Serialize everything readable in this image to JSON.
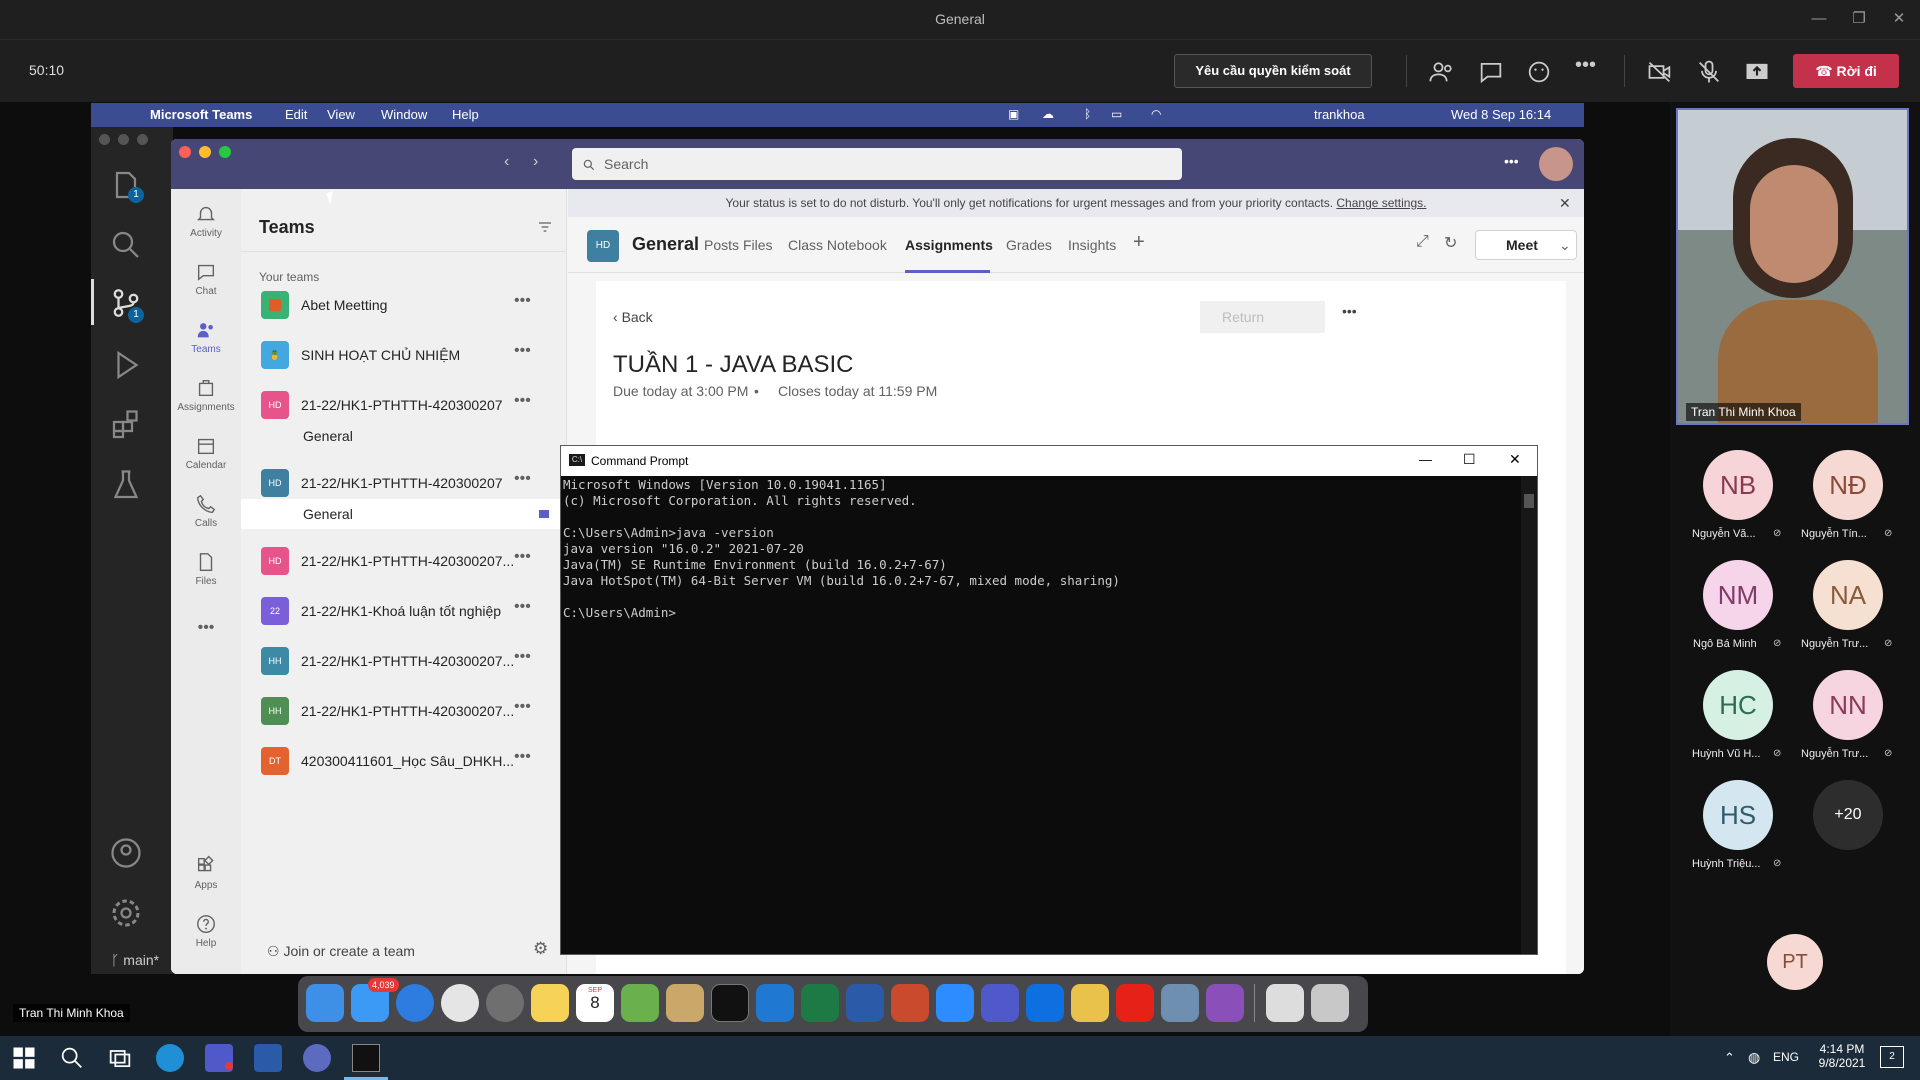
{
  "window": {
    "title": "General"
  },
  "callbar": {
    "timer": "50:10",
    "request_control": "Yêu cầu quyền kiểm soát",
    "leave": "Rời đi"
  },
  "macbar": {
    "app": "Microsoft Teams",
    "menus": [
      "Edit",
      "View",
      "Window",
      "Help"
    ],
    "user": "trankhoa",
    "datetime": "Wed 8 Sep  16:14"
  },
  "vscode": {
    "branch": "main*",
    "badge1": "1",
    "badge2": "1"
  },
  "teams": {
    "search_placeholder": "Search",
    "rail": [
      "Activity",
      "Chat",
      "Teams",
      "Assignments",
      "Calendar",
      "Calls",
      "Files",
      "Apps",
      "Help"
    ],
    "pane_title": "Teams",
    "your_teams": "Your teams",
    "team_list": [
      {
        "name": "Abet Meetting",
        "abbr": "",
        "color": "#38b275"
      },
      {
        "name": "SINH HOẠT CHỦ NHIỆM",
        "abbr": "",
        "color": "#44a7e0"
      },
      {
        "name": "21-22/HK1-PTHTTH-420300207",
        "abbr": "HD",
        "color": "#e7548c"
      },
      {
        "name": "21-22/HK1-PTHTTH-420300207",
        "abbr": "HD",
        "color": "#3f7fa0"
      },
      {
        "name": "21-22/HK1-PTHTTH-420300207...",
        "abbr": "HD",
        "color": "#e7548c"
      },
      {
        "name": "21-22/HK1-Khoá luận tốt nghiệp",
        "abbr": "22",
        "color": "#7b5fd8"
      },
      {
        "name": "21-22/HK1-PTHTTH-420300207...",
        "abbr": "HH",
        "color": "#3d8aa6"
      },
      {
        "name": "21-22/HK1-PTHTTH-420300207...",
        "abbr": "HH",
        "color": "#4f8e54"
      },
      {
        "name": "420300411601_Học Sâu_DHKH...",
        "abbr": "DT",
        "color": "#e3622f"
      }
    ],
    "channel_general": "General",
    "join_create": "Join or create a team",
    "banner": "Your status is set to do not disturb. You'll only get notifications for urgent messages and from your priority contacts.",
    "banner_link": "Change settings.",
    "channel": {
      "abbr": "HD",
      "name": "General",
      "tabs": [
        "Posts",
        "Files",
        "Class Notebook",
        "Assignments",
        "Grades",
        "Insights"
      ],
      "meet": "Meet"
    },
    "assignment": {
      "back": "Back",
      "return": "Return",
      "title": "TUẦN 1 - JAVA BASIC",
      "due": "Due today at 3:00 PM",
      "closes": "Closes today at 11:59 PM"
    }
  },
  "cmd": {
    "title": "Command Prompt",
    "lines": "Microsoft Windows [Version 10.0.19041.1165]\n(c) Microsoft Corporation. All rights reserved.\n\nC:\\Users\\Admin>java -version\njava version \"16.0.2\" 2021-07-20\nJava(TM) SE Runtime Environment (build 16.0.2+7-67)\nJava HotSpot(TM) 64-Bit Server VM (build 16.0.2+7-67, mixed mode, sharing)\n\nC:\\Users\\Admin>"
  },
  "dock": {
    "mail_badge": "4,039",
    "calendar_day": "8",
    "calendar_month": "SEP"
  },
  "presenter_label": "Tran Thi Minh Khoa",
  "participants": {
    "speaker": "Tran Thi Minh Khoa",
    "list": [
      {
        "initials": "NB",
        "name": "Nguyễn Vă..."
      },
      {
        "initials": "NĐ",
        "name": "Nguyễn Tín..."
      },
      {
        "initials": "NM",
        "name": "Ngô Bá Minh"
      },
      {
        "initials": "NA",
        "name": "Nguyễn Trư..."
      },
      {
        "initials": "HC",
        "name": "Huỳnh Vũ H..."
      },
      {
        "initials": "NN",
        "name": "Nguyễn Trư..."
      },
      {
        "initials": "HS",
        "name": "Huỳnh Triệu..."
      }
    ],
    "more": "+20",
    "self": "PT"
  },
  "taskbar": {
    "lang": "ENG",
    "time": "4:14 PM",
    "date": "9/8/2021",
    "notif": "2"
  }
}
